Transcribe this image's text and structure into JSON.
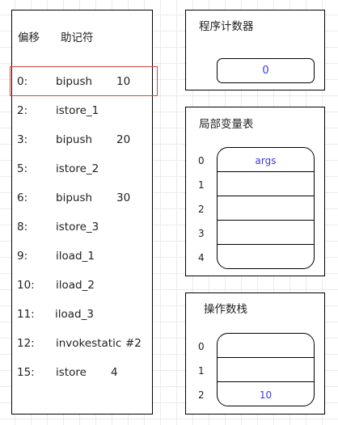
{
  "bytecode": {
    "header_offset": "偏移",
    "header_mnemonic": "助记符",
    "rows": [
      {
        "offset": "0:",
        "op": "bipush",
        "arg": "10"
      },
      {
        "offset": "2:",
        "op": "istore_1",
        "arg": ""
      },
      {
        "offset": "3:",
        "op": "bipush",
        "arg": "20"
      },
      {
        "offset": "5:",
        "op": "istore_2",
        "arg": ""
      },
      {
        "offset": "6:",
        "op": "bipush",
        "arg": "30"
      },
      {
        "offset": "8:",
        "op": "istore_3",
        "arg": ""
      },
      {
        "offset": "9:",
        "op": "iload_1",
        "arg": ""
      },
      {
        "offset": "10:",
        "op": "iload_2",
        "arg": ""
      },
      {
        "offset": "11:",
        "op": "iload_3",
        "arg": ""
      },
      {
        "offset": "12:",
        "op": "invokestatic",
        "arg": "#2"
      },
      {
        "offset": "15:",
        "op": "istore",
        "arg": "4"
      }
    ],
    "highlighted_index": 0,
    "highlight_color": "#d64541"
  },
  "pc": {
    "title": "程序计数器",
    "value": "0"
  },
  "locals": {
    "title": "局部变量表",
    "slots": [
      {
        "index": "0",
        "value": "args"
      },
      {
        "index": "1",
        "value": ""
      },
      {
        "index": "2",
        "value": ""
      },
      {
        "index": "3",
        "value": ""
      },
      {
        "index": "4",
        "value": ""
      }
    ]
  },
  "stack": {
    "title": "操作数栈",
    "slots": [
      {
        "index": "0",
        "value": ""
      },
      {
        "index": "1",
        "value": ""
      },
      {
        "index": "2",
        "value": "10"
      }
    ]
  },
  "colors": {
    "value_text": "#3a3ae0"
  }
}
